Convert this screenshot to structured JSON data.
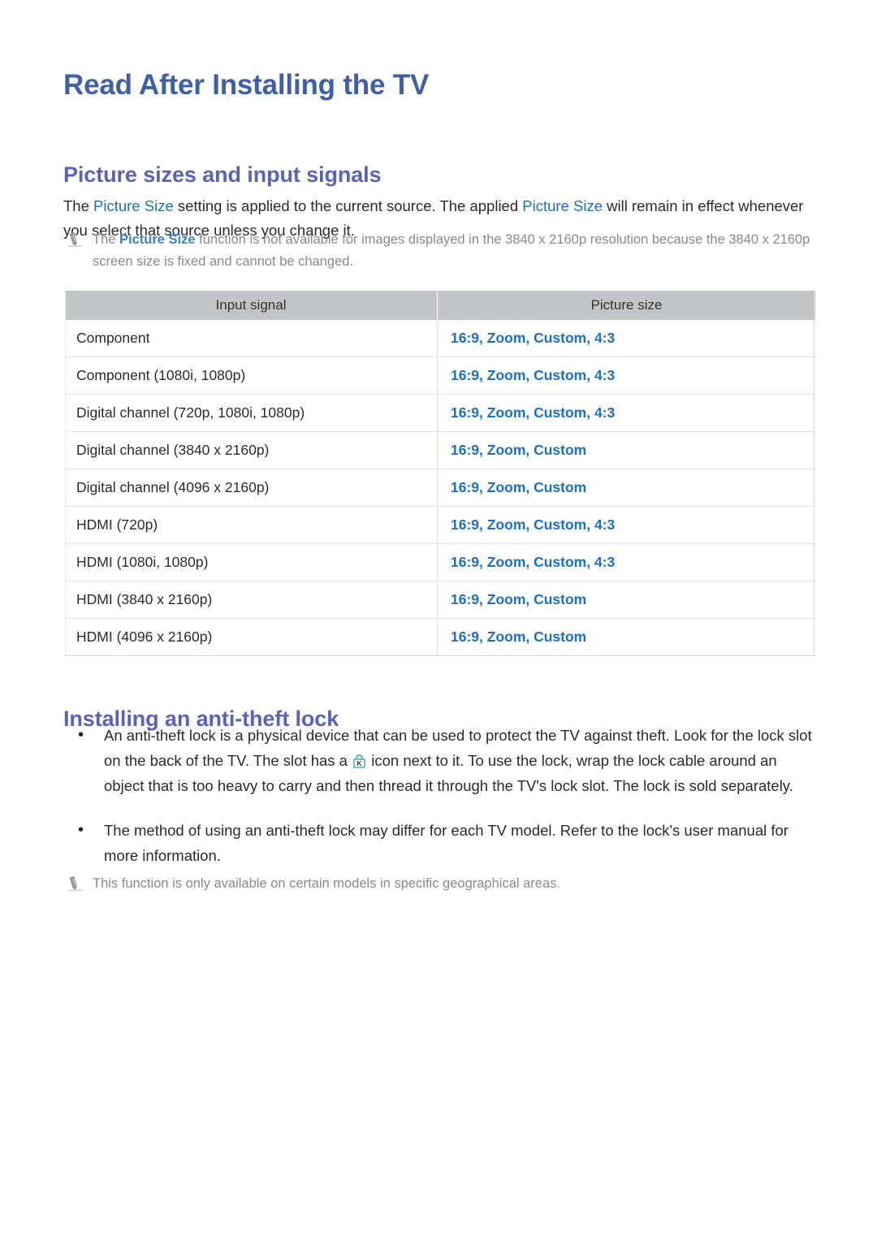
{
  "document": {
    "title": "Read After Installing the TV"
  },
  "sections": {
    "picture_sizes": {
      "heading": "Picture sizes and input signals",
      "intro_parts": {
        "p1": "The ",
        "link1": "Picture Size",
        "p2": " setting is applied to the current source. The applied ",
        "link2": "Picture Size",
        "p3": " will remain in effect whenever you select that source unless you change it."
      },
      "note": {
        "icon": "pencil-note-icon",
        "parts": {
          "p1": "The ",
          "link1": "Picture Size",
          "p2": " function is not available for images displayed in the 3840 x 2160p resolution because the 3840 x 2160p screen size is fixed and cannot be changed."
        }
      },
      "table": {
        "headers": [
          "Input signal",
          "Picture size"
        ],
        "rows": [
          {
            "signal": "Component",
            "size": "16:9, Zoom, Custom, 4:3"
          },
          {
            "signal": "Component (1080i, 1080p)",
            "size": "16:9, Zoom, Custom, 4:3"
          },
          {
            "signal": "Digital channel (720p, 1080i, 1080p)",
            "size": "16:9, Zoom, Custom, 4:3"
          },
          {
            "signal": "Digital channel (3840 x 2160p)",
            "size": "16:9, Zoom, Custom"
          },
          {
            "signal": "Digital channel (4096 x 2160p)",
            "size": "16:9, Zoom, Custom"
          },
          {
            "signal": "HDMI (720p)",
            "size": "16:9, Zoom, Custom, 4:3"
          },
          {
            "signal": "HDMI (1080i, 1080p)",
            "size": "16:9, Zoom, Custom, 4:3"
          },
          {
            "signal": "HDMI (3840 x 2160p)",
            "size": "16:9, Zoom, Custom"
          },
          {
            "signal": "HDMI (4096 x 2160p)",
            "size": "16:9, Zoom, Custom"
          }
        ]
      }
    },
    "anti_theft_lock": {
      "heading": "Installing an anti-theft lock",
      "bullets": [
        {
          "marker": "•",
          "parts": {
            "p1": "An anti-theft lock is a physical device that can be used to protect the TV against theft. Look for the lock slot on the back of the TV. The slot has a ",
            "icon": "kensington-lock-icon",
            "p2": " icon next to it. To use the lock, wrap the lock cable around an object that is too heavy to carry and then thread it through the TV's lock slot. The lock is sold separately."
          }
        },
        {
          "marker": "•",
          "text": "The method of using an anti-theft lock may differ for each TV model. Refer to the lock's user manual for more information."
        }
      ],
      "note": {
        "icon": "pencil-note-icon",
        "text": "This function is only available on certain models in specific geographical areas."
      }
    }
  },
  "colors": {
    "title_blue": "#3f5fa8",
    "heading_blue": "#5a63b8",
    "link_blue": "#1b6fc4",
    "note_gray": "#8a8a8a",
    "table_header_gray": "#c3c4c6",
    "lock_icon_teal": "#3aa8b8"
  }
}
